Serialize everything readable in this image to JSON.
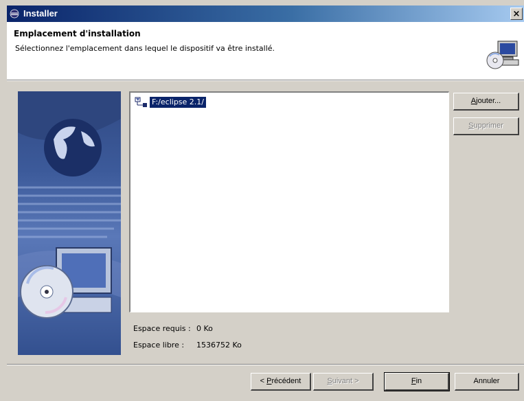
{
  "window": {
    "title": "Installer",
    "close_label": "×"
  },
  "header": {
    "title": "Emplacement d'installation",
    "description": "Sélectionnez l'emplacement dans lequel le dispositif va être installé."
  },
  "locations": [
    {
      "path": "F:/eclipse 2.1/",
      "selected": true
    }
  ],
  "side_buttons": {
    "add": {
      "mnemonic": "A",
      "rest": "jouter..."
    },
    "remove": {
      "mnemonic": "S",
      "rest": "upprimer"
    }
  },
  "space": {
    "required_label": "Espace requis :",
    "required_value": "0 Ko",
    "free_label": "Espace libre :",
    "free_value": "1536752 Ko"
  },
  "footer": {
    "back": {
      "prefix": "< ",
      "mnemonic": "P",
      "rest": "récédent"
    },
    "next": {
      "mnemonic": "S",
      "rest": "uivant >"
    },
    "finish": {
      "mnemonic": "F",
      "rest": "in"
    },
    "cancel": "Annuler"
  },
  "colors": {
    "title_bar": "#0a246a",
    "selection": "#0a246a",
    "dialog": "#d4d0c8"
  }
}
